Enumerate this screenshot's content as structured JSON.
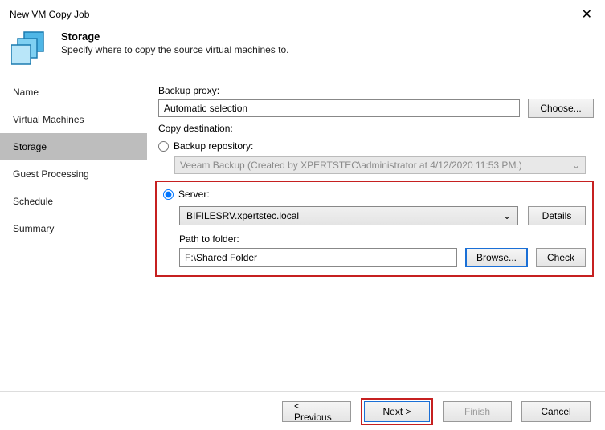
{
  "window": {
    "title": "New VM Copy Job",
    "close_glyph": "✕"
  },
  "header": {
    "title": "Storage",
    "subtitle": "Specify where to copy the source virtual machines to."
  },
  "sidebar": {
    "items": [
      {
        "label": "Name"
      },
      {
        "label": "Virtual Machines"
      },
      {
        "label": "Storage"
      },
      {
        "label": "Guest Processing"
      },
      {
        "label": "Schedule"
      },
      {
        "label": "Summary"
      }
    ],
    "selected_index": 2
  },
  "main": {
    "proxy_label": "Backup proxy:",
    "proxy_value": "Automatic selection",
    "choose_label": "Choose...",
    "dest_label": "Copy destination:",
    "radio_repo_label": "Backup repository:",
    "repo_value": "Veeam Backup (Created by XPERTSTEC\\administrator at 4/12/2020 11:53 PM.)",
    "radio_server_label": "Server:",
    "server_value": "BIFILESRV.xpertstec.local",
    "details_label": "Details",
    "path_label": "Path to folder:",
    "path_value": "F:\\Shared Folder",
    "browse_label": "Browse...",
    "check_label": "Check",
    "chevron": "⌄"
  },
  "footer": {
    "previous": "< Previous",
    "next": "Next >",
    "finish": "Finish",
    "cancel": "Cancel"
  }
}
